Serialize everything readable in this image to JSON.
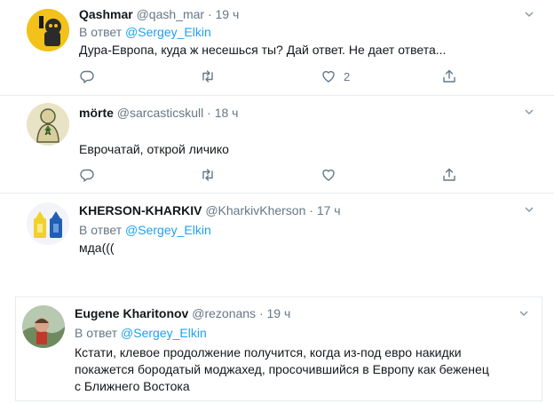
{
  "tweets": [
    {
      "name": "Qashmar",
      "handle": "@qash_mar",
      "dot": "·",
      "time": "19 ч",
      "reply_prefix": "В ответ",
      "reply_mention": "@Sergey_Elkin",
      "lines": [
        "Дура-Европа, куда ж несешься ты? Дай ответ. Не дает ответа..."
      ],
      "like_count": "2"
    },
    {
      "name": "mörte",
      "handle": "@sarcasticskull",
      "dot": "·",
      "time": "18 ч",
      "reply_prefix": "",
      "reply_mention": "",
      "lines": [
        "Еврочатай, открой личико"
      ],
      "like_count": ""
    },
    {
      "name": "KHERSON-KHARKIV",
      "handle": "@KharkivKherson",
      "dot": "·",
      "time": "17 ч",
      "reply_prefix": "В ответ",
      "reply_mention": "@Sergey_Elkin",
      "lines": [
        "мда((("
      ],
      "like_count": ""
    },
    {
      "name": "Eugene Kharitonov",
      "handle": "@rezonans",
      "dot": "·",
      "time": "19 ч",
      "reply_prefix": "В ответ",
      "reply_mention": "@Sergey_Elkin",
      "lines": [
        "Кстати, клевое продолжение получится, когда из-под евро накидки",
        "покажется бородатый моджахед, просочившийся в Европу как беженец",
        "с Ближнего Востока"
      ],
      "like_count": ""
    }
  ],
  "icons": {
    "reply": "reply-icon",
    "retweet": "retweet-icon",
    "like": "heart-icon",
    "share": "share-icon",
    "menu": "chevron-down-icon"
  },
  "colors": {
    "link": "#1da1f2",
    "secondary": "#657786",
    "text": "#14171a",
    "border": "#e6ecf0"
  }
}
